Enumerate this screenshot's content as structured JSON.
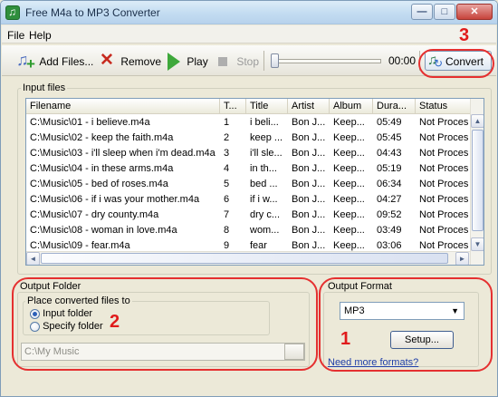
{
  "window": {
    "title": "Free M4a to MP3 Converter"
  },
  "window_buttons": {
    "minimize": "—",
    "maximize": "□",
    "close": "✕"
  },
  "menu": {
    "file": "File",
    "help": "Help"
  },
  "toolbar": {
    "add_files": "Add Files...",
    "remove": "Remove",
    "play": "Play",
    "stop": "Stop",
    "time": "00:00",
    "convert": "Convert",
    "position_fraction": 0.0
  },
  "annotations": {
    "one": "1",
    "two": "2",
    "three": "3"
  },
  "input_files": {
    "group_title": "Input files",
    "columns": [
      "Filename",
      "T...",
      "Title",
      "Artist",
      "Album",
      "Dura...",
      "Status"
    ],
    "rows": [
      [
        "C:\\Music\\01 - i believe.m4a",
        "1",
        "i beli...",
        "Bon J...",
        "Keep...",
        "05:49",
        "Not Proces"
      ],
      [
        "C:\\Music\\02 - keep the faith.m4a",
        "2",
        "keep ...",
        "Bon J...",
        "Keep...",
        "05:45",
        "Not Proces"
      ],
      [
        "C:\\Music\\03 - i'll sleep when i'm dead.m4a",
        "3",
        "i'll sle...",
        "Bon J...",
        "Keep...",
        "04:43",
        "Not Proces"
      ],
      [
        "C:\\Music\\04 - in these arms.m4a",
        "4",
        "in th...",
        "Bon J...",
        "Keep...",
        "05:19",
        "Not Proces"
      ],
      [
        "C:\\Music\\05 - bed of roses.m4a",
        "5",
        "bed ...",
        "Bon J...",
        "Keep...",
        "06:34",
        "Not Proces"
      ],
      [
        "C:\\Music\\06 - if i was your mother.m4a",
        "6",
        "if i w...",
        "Bon J...",
        "Keep...",
        "04:27",
        "Not Proces"
      ],
      [
        "C:\\Music\\07 - dry county.m4a",
        "7",
        "dry c...",
        "Bon J...",
        "Keep...",
        "09:52",
        "Not Proces"
      ],
      [
        "C:\\Music\\08 - woman in love.m4a",
        "8",
        "wom...",
        "Bon J...",
        "Keep...",
        "03:49",
        "Not Proces"
      ],
      [
        "C:\\Music\\09 - fear.m4a",
        "9",
        "fear",
        "Bon J...",
        "Keep...",
        "03:06",
        "Not Proces"
      ]
    ]
  },
  "output_folder": {
    "group_title": "Output Folder",
    "subgroup_title": "Place converted files to",
    "option_input": "Input folder",
    "option_specify": "Specify folder",
    "selected": "Input folder",
    "folder_value": "C:\\My Music"
  },
  "output_format": {
    "group_title": "Output Format",
    "selected": "MP3",
    "setup_label": "Setup...",
    "more_formats": "Need more formats?"
  },
  "colors": {
    "annotation": "#e53030",
    "link": "#1f3ea8",
    "window_bg": "#ece9d8"
  }
}
